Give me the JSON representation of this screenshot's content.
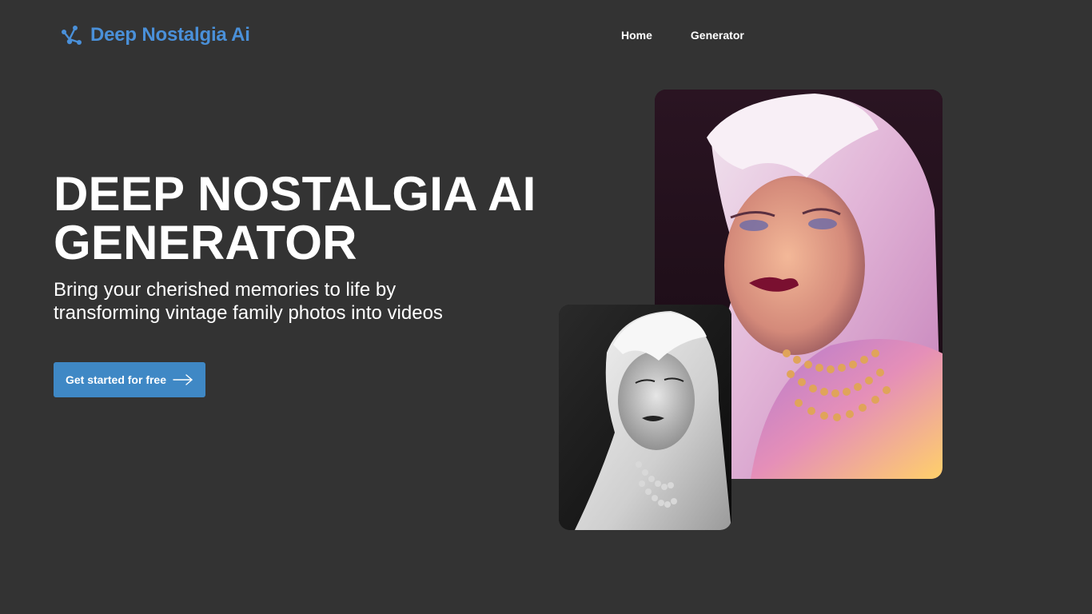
{
  "header": {
    "brand": {
      "name": "Deep Nostalgia Ai",
      "icon": "network-nodes-icon",
      "color": "#4a90d9"
    },
    "nav": [
      {
        "label": "Home"
      },
      {
        "label": "Generator"
      }
    ]
  },
  "hero": {
    "title_lines": [
      "DEEP NOSTALGIA AI",
      "GENERATOR"
    ],
    "subtitle_lines": [
      "Bring your cherished memories to life by",
      "transforming vintage family photos into videos"
    ],
    "cta": {
      "label": "Get started for free",
      "icon": "arrow-right-icon",
      "color": "#3f88c5"
    }
  },
  "images": {
    "colorized": {
      "description_icon": "colorized-portrait-image"
    },
    "original": {
      "description_icon": "black-and-white-portrait-image"
    }
  },
  "colors": {
    "background": "#333333",
    "accent": "#4a90d9"
  }
}
